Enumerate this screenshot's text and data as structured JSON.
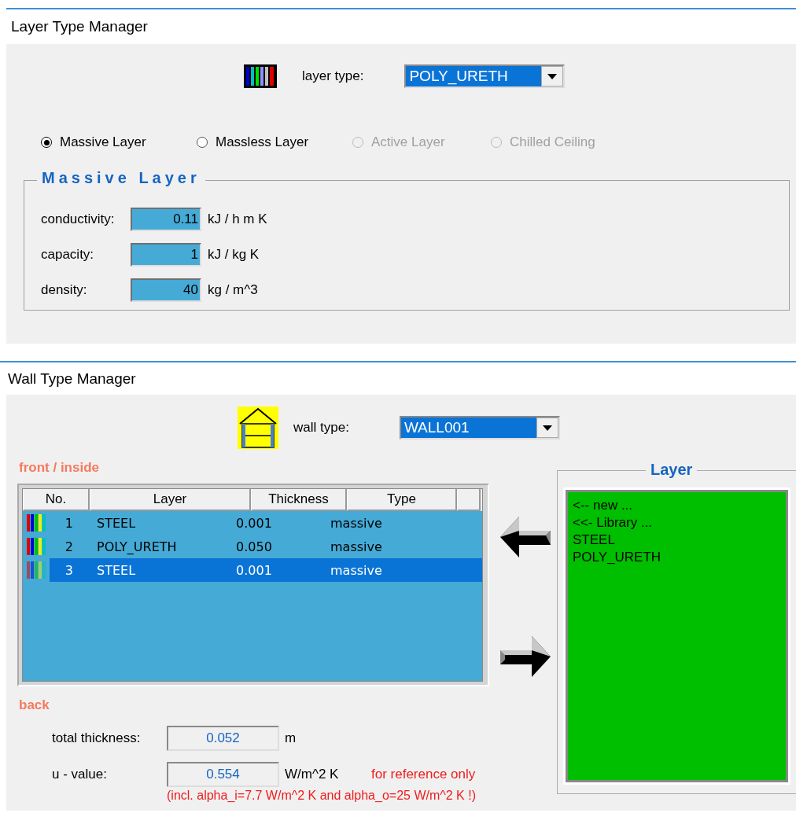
{
  "layer_type_manager": {
    "title": "Layer Type Manager",
    "layer_type_label": "layer type:",
    "layer_type": "POLY_URETH",
    "radios": [
      {
        "label": "Massive Layer",
        "selected": true,
        "disabled": false
      },
      {
        "label": "Massless Layer",
        "selected": false,
        "disabled": false
      },
      {
        "label": "Active Layer",
        "selected": false,
        "disabled": true
      },
      {
        "label": "Chilled Ceiling",
        "selected": false,
        "disabled": true
      }
    ],
    "group_title": "Massive Layer",
    "properties": [
      {
        "label": "conductivity:",
        "value": "0.11",
        "unit": "kJ / h m K"
      },
      {
        "label": "capacity:",
        "value": "1",
        "unit": "kJ / kg K"
      },
      {
        "label": "density:",
        "value": "40",
        "unit": "kg / m^3"
      }
    ]
  },
  "wall_type_manager": {
    "title": "Wall Type Manager",
    "wall_type_label": "wall type:",
    "wall_type": "WALL001",
    "front_label": "front / inside",
    "table": {
      "columns": [
        "No.",
        "Layer",
        "Thickness",
        "Type"
      ],
      "rows": [
        {
          "no": "1",
          "layer": "STEEL",
          "thickness": "0.001",
          "type": "massive",
          "selected": false
        },
        {
          "no": "2",
          "layer": "POLY_URETH",
          "thickness": "0.050",
          "type": "massive",
          "selected": false
        },
        {
          "no": "3",
          "layer": "STEEL",
          "thickness": "0.001",
          "type": "massive",
          "selected": true
        }
      ]
    },
    "back_label": "back",
    "results": [
      {
        "label": "total thickness:",
        "value": "0.052",
        "unit": "m"
      },
      {
        "label": "u - value:",
        "value": "0.554",
        "unit": "W/m^2 K",
        "note": "for reference only"
      }
    ],
    "footnote": "(incl. alpha_i=7.7 W/m^2 K and alpha_o=25 W/m^2 K !)",
    "layer_group": {
      "title": "Layer",
      "items": [
        "<-- new ...",
        "<<- Library ...",
        "STEEL",
        "POLY_URETH"
      ]
    }
  }
}
